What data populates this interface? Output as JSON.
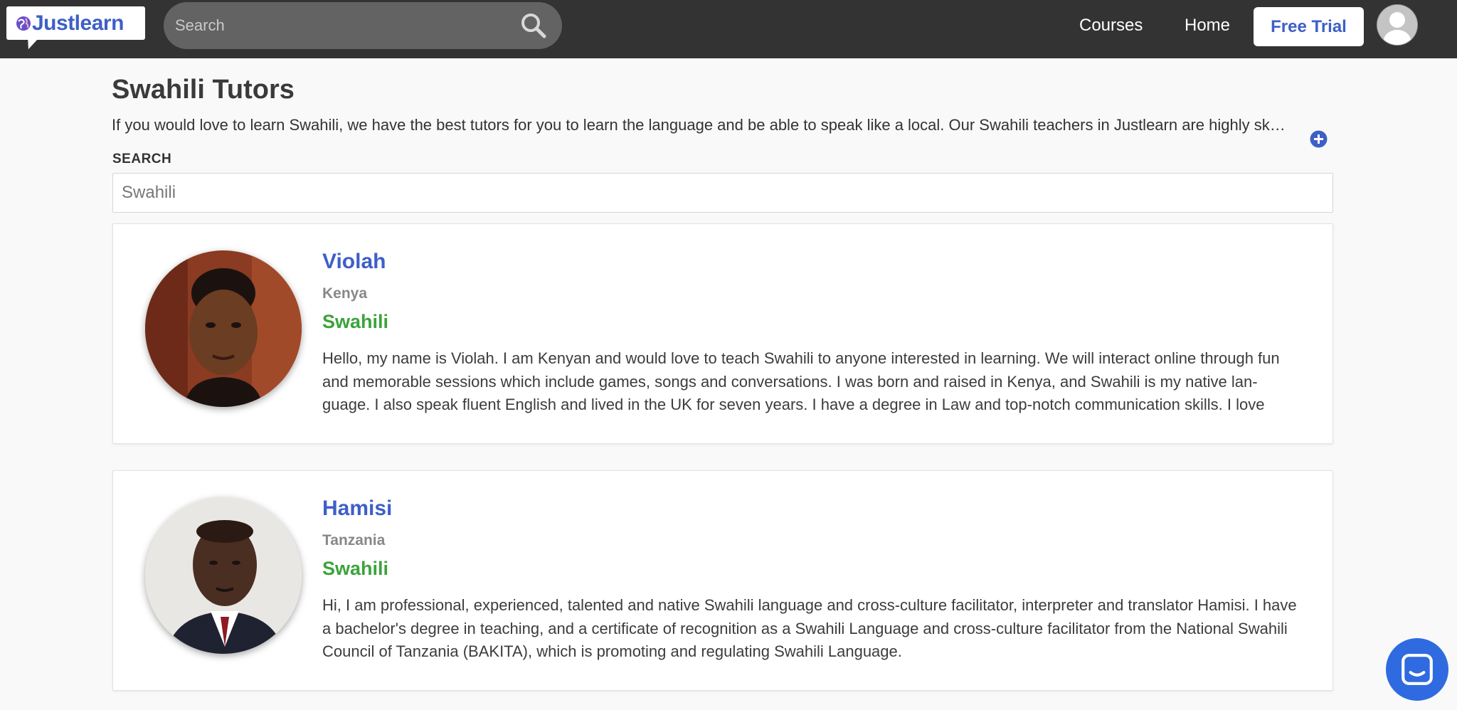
{
  "navbar": {
    "logo_text": "Justlearn",
    "search_placeholder": "Search",
    "links": [
      "Courses",
      "Home"
    ],
    "cta_label": "Free Trial"
  },
  "page": {
    "title": "Swahili Tutors",
    "intro": "If you would love to learn Swahili, we have the best tutors for you to learn the language and be able to speak like a local. Our Swahili teachers in Justlearn are highly sk…",
    "search_label": "SEARCH",
    "search_value": "Swahili"
  },
  "tutors": [
    {
      "name": "Violah",
      "country": "Kenya",
      "language": "Swahili",
      "bio": "Hello, my name is Violah. I am Kenyan and would love to teach Swahili to anyone interested in learning. We will interact online through fun and memorable sessions which include games, songs and conversations. I was born and raised in Kenya, and Swahili is my native lan-guage. I also speak fluent English and lived in the UK for seven years. I have a degree in Law and top-notch communication skills. I love"
    },
    {
      "name": "Hamisi",
      "country": "Tanzania",
      "language": "Swahili",
      "bio": "Hi, I am professional, experienced, talented and native Swahili language and cross-culture facilitator, interpreter and translator Hamisi. I have a bachelor's degree in teaching, and a certificate of recognition as a Swahili Language and cross-culture facilitator from the National Swahili Council of Tanzania (BAKITA), which is promoting and regulating Swahili Language."
    }
  ],
  "colors": {
    "navbar": "#333333",
    "brand_blue": "#3e5fc7",
    "language_green": "#3ba33b",
    "chat_blue": "#2f6ae0"
  },
  "icons": {
    "logo": "globe-icon",
    "search": "search-icon",
    "expand": "plus-circle-icon",
    "avatar": "user-icon",
    "chat": "chat-icon"
  }
}
